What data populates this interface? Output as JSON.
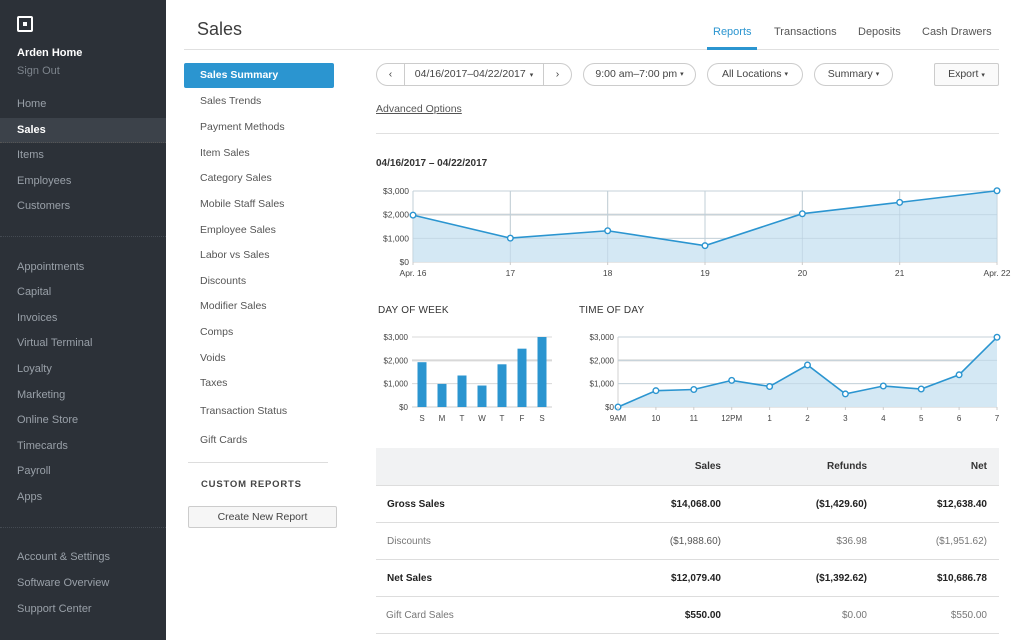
{
  "sidebar": {
    "account_name": "Arden Home",
    "sign_out": "Sign Out",
    "primary": [
      {
        "label": "Home",
        "active": false
      },
      {
        "label": "Sales",
        "active": true
      },
      {
        "label": "Items",
        "active": false
      },
      {
        "label": "Employees",
        "active": false
      },
      {
        "label": "Customers",
        "active": false
      }
    ],
    "secondary": [
      {
        "label": "Appointments"
      },
      {
        "label": "Capital"
      },
      {
        "label": "Invoices"
      },
      {
        "label": "Virtual Terminal"
      },
      {
        "label": "Loyalty"
      },
      {
        "label": "Marketing"
      },
      {
        "label": "Online Store"
      },
      {
        "label": "Timecards"
      },
      {
        "label": "Payroll"
      },
      {
        "label": "Apps"
      }
    ],
    "tertiary": [
      {
        "label": "Account & Settings"
      },
      {
        "label": "Software Overview"
      },
      {
        "label": "Support Center"
      }
    ]
  },
  "header": {
    "title": "Sales",
    "tabs": [
      {
        "label": "Reports",
        "active": true
      },
      {
        "label": "Transactions",
        "active": false
      },
      {
        "label": "Deposits",
        "active": false
      },
      {
        "label": "Cash Drawers",
        "active": false
      }
    ]
  },
  "reports": {
    "active": "Sales Summary",
    "items": [
      "Sales Trends",
      "Payment Methods",
      "Item Sales",
      "Category Sales",
      "Mobile Staff Sales",
      "Employee Sales",
      "Labor vs Sales",
      "Discounts",
      "Modifier Sales",
      "Comps",
      "Voids",
      "Taxes",
      "Transaction Status",
      "Gift Cards"
    ],
    "custom_title": "CUSTOM REPORTS",
    "create_button": "Create New Report"
  },
  "toolbar": {
    "prev_icon": "‹",
    "date_range": "04/16/2017–04/22/2017",
    "next_icon": "›",
    "time_range": "9:00 am–7:00 pm",
    "location": "All Locations",
    "view": "Summary",
    "export": "Export",
    "chevron": "⌄",
    "advanced_options": "Advanced Options"
  },
  "chart_data": [
    {
      "type": "area",
      "title": "04/16/2017 – 04/22/2017",
      "categories": [
        "Apr. 16",
        "17",
        "18",
        "19",
        "20",
        "21",
        "Apr. 22"
      ],
      "values": [
        1980,
        1010,
        1320,
        690,
        2040,
        2520,
        3010
      ],
      "ylim": [
        0,
        3000
      ],
      "yticks": [
        "$0",
        "$1,000",
        "$2,000",
        "$3,000"
      ],
      "grid": true,
      "color": "#2b95d0",
      "fill": "#d2e7f3"
    },
    {
      "type": "bar",
      "title": "DAY OF WEEK",
      "categories": [
        "S",
        "M",
        "T",
        "W",
        "T",
        "F",
        "S"
      ],
      "values": [
        1920,
        990,
        1350,
        920,
        1830,
        2500,
        3000
      ],
      "ylim": [
        0,
        3000
      ],
      "yticks": [
        "$0",
        "$1,000",
        "$2,000",
        "$3,000"
      ],
      "grid": true,
      "color": "#2b95d0"
    },
    {
      "type": "area",
      "title": "TIME OF DAY",
      "categories": [
        "9AM",
        "10",
        "11",
        "12PM",
        "1",
        "2",
        "3",
        "4",
        "5",
        "6",
        "7"
      ],
      "values": [
        0,
        700,
        750,
        1140,
        880,
        1800,
        560,
        900,
        770,
        1380,
        2990
      ],
      "ylim": [
        0,
        3000
      ],
      "yticks": [
        "$0",
        "$1,000",
        "$2,000",
        "$3,000"
      ],
      "grid": true,
      "color": "#2b95d0",
      "fill": "#d2e7f3"
    }
  ],
  "table": {
    "headers": [
      "",
      "Sales",
      "Refunds",
      "Net"
    ],
    "rows": [
      {
        "label": "Gross Sales",
        "sales": "$14,068.00",
        "refunds": "($1,429.60)",
        "net": "$12,638.40",
        "style": "bold"
      },
      {
        "label": "Discounts",
        "sales": "($1,988.60)",
        "refunds": "$36.98",
        "net": "($1,951.62)",
        "style": "light"
      },
      {
        "label": "Net Sales",
        "sales": "$12,079.40",
        "refunds": "($1,392.62)",
        "net": "$10,686.78",
        "style": "bold"
      },
      {
        "label": "Gift Card Sales",
        "sales": "$550.00",
        "refunds": "$0.00",
        "net": "$550.00",
        "style": "gift"
      }
    ]
  }
}
